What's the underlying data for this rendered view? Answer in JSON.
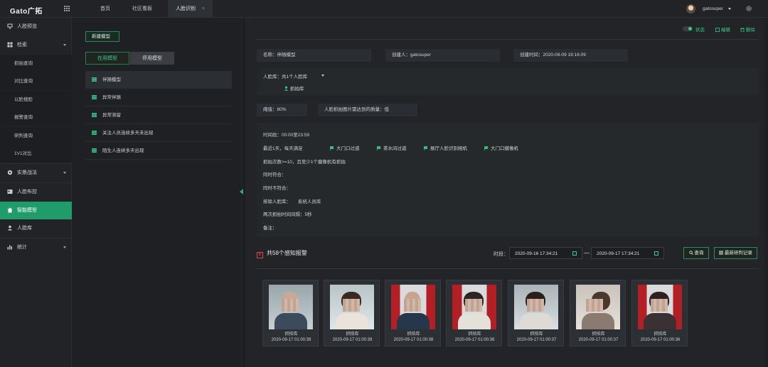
{
  "header": {
    "logo": "Gato广拓",
    "tabs": [
      {
        "label": "首页"
      },
      {
        "label": "社区看板"
      },
      {
        "label": "人脸识别",
        "close": "×"
      }
    ],
    "user": "gatosuper"
  },
  "sidebar": {
    "items": [
      {
        "label": "人脸预览"
      },
      {
        "label": "检索"
      },
      {
        "label": "抓拍查询"
      },
      {
        "label": "对比查询"
      },
      {
        "label": "以脸搜脸"
      },
      {
        "label": "报警查询"
      },
      {
        "label": "研判查询"
      },
      {
        "label": "1V1对比"
      },
      {
        "label": "实景战法"
      },
      {
        "label": "人脸布控"
      },
      {
        "label": "智能模型"
      },
      {
        "label": "人脸库"
      },
      {
        "label": "统计"
      }
    ]
  },
  "left": {
    "new_model": "新建模型",
    "seg_on": "在用模型",
    "seg_off": "停用模型",
    "models": [
      "伴随模型",
      "异常伴随",
      "异常滞留",
      "关注人员连续多天未出现",
      "陌生人连续多天出现"
    ]
  },
  "toolbar": {
    "status": "状态",
    "edit": "编辑",
    "delete": "删除"
  },
  "detail": {
    "name": "名称：伴随模型",
    "creator": "创建人：gatosuper",
    "created": "创建时间：2020-09-09 19:16:09",
    "library_line": "人脸库：共1个人脸库",
    "library_name": "抓拍库",
    "threshold": "阈值：80%",
    "quality": "人脸抓拍图片需达到的质量：低",
    "rule_time": "时间段：00:00至23:59",
    "rule_days": "最近1天，每天满足",
    "cameras": [
      "大门口过道",
      "茶水间过道",
      "展厅人脸识别相机",
      "大门口摄像机"
    ],
    "rule_count": "抓拍次数>=10，且至少1个摄像机有抓拍",
    "rule_and": "同时符合：",
    "rule_not": "同时不符合：",
    "rule_exclude_label": "排除人脸库：",
    "rule_exclude_value": "系统人员库",
    "rule_interval": "两次抓拍时间间隔：5秒",
    "rule_note": "备注："
  },
  "alerts": {
    "badge": "B",
    "title": "共58个感知报警",
    "time_label": "时段：",
    "from": "2020-09-16 17:34:21",
    "to": "2020-09-17 17:34:21",
    "query": "查询",
    "export": "最新研判记录",
    "cards": [
      {
        "lib": "抓拍库",
        "ts": "2020-09-17 01:00:39"
      },
      {
        "lib": "抓拍库",
        "ts": "2020-09-17 01:00:39"
      },
      {
        "lib": "抓拍库",
        "ts": "2020-09-17 01:00:38"
      },
      {
        "lib": "抓拍库",
        "ts": "2020-09-17 01:00:38"
      },
      {
        "lib": "抓拍库",
        "ts": "2020-09-17 01:00:37"
      },
      {
        "lib": "抓拍库",
        "ts": "2020-09-17 01:00:37"
      },
      {
        "lib": "抓拍库",
        "ts": "2020-09-17 01:00:36"
      }
    ]
  },
  "colors": {
    "accent": "#1f9c6a",
    "accent_text": "#39c98b",
    "alert": "#d94c4c"
  }
}
